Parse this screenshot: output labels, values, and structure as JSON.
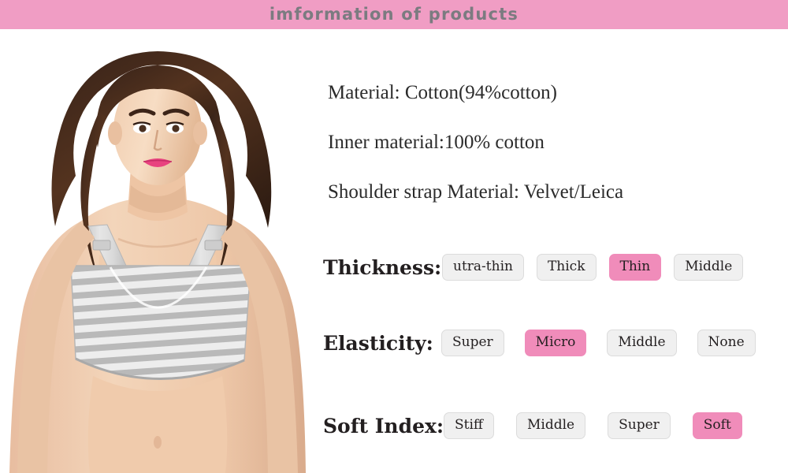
{
  "header": {
    "title": "imformation of products",
    "background_color": "#f09dc4",
    "text_color": "#7b7b80"
  },
  "photo": {
    "alt": "model wearing grey and white striped wireless bra",
    "background_color": "#ffffff"
  },
  "specs": [
    {
      "key": "material",
      "text": "Material: Cotton(94%cotton)"
    },
    {
      "key": "inner_material",
      "text": "Inner material:100% cotton"
    },
    {
      "key": "strap_material",
      "text": "Shoulder strap Material: Velvet/Leica"
    }
  ],
  "attributes": [
    {
      "key": "thickness",
      "label": "Thickness:",
      "selected": "Thin",
      "options": [
        {
          "label": "utra-thin",
          "selected": false
        },
        {
          "label": "Thick",
          "selected": false
        },
        {
          "label": "Thin",
          "selected": true
        },
        {
          "label": "Middle",
          "selected": false
        }
      ]
    },
    {
      "key": "elasticity",
      "label": "Elasticity:",
      "selected": "Micro",
      "options": [
        {
          "label": "Super",
          "selected": false
        },
        {
          "label": "Micro",
          "selected": true
        },
        {
          "label": "Middle",
          "selected": false
        },
        {
          "label": "None",
          "selected": false
        }
      ]
    },
    {
      "key": "soft_index",
      "label": "Soft Index:",
      "selected": "Soft",
      "options": [
        {
          "label": "Stiff",
          "selected": false
        },
        {
          "label": "Middle",
          "selected": false
        },
        {
          "label": "Super",
          "selected": false
        },
        {
          "label": "Soft",
          "selected": true
        }
      ]
    }
  ],
  "colors": {
    "accent_pink": "#f09dc4",
    "chip_selected": "#f08cba",
    "chip_idle": "#f0f0f0",
    "chip_border": "#dcdcdc",
    "body_text": "#2b2b2b"
  }
}
